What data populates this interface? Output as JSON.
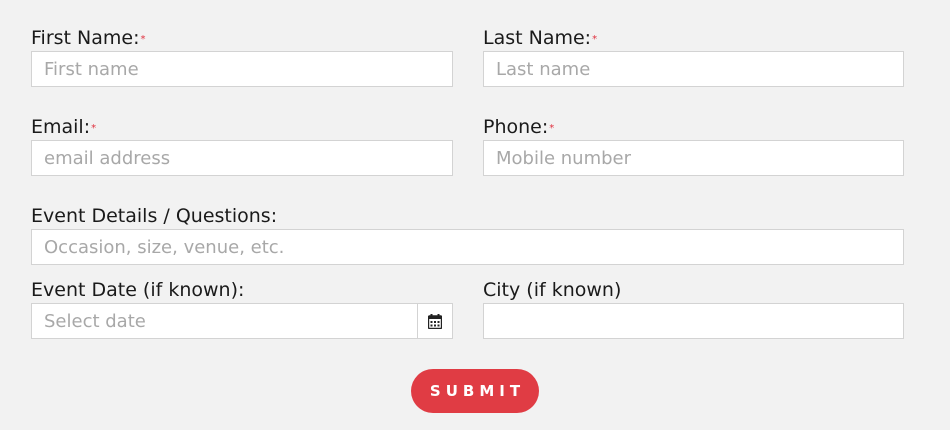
{
  "fields": {
    "first_name": {
      "label": "First Name:",
      "required": "*",
      "placeholder": "First name",
      "value": ""
    },
    "last_name": {
      "label": "Last Name:",
      "required": "*",
      "placeholder": "Last name",
      "value": ""
    },
    "email": {
      "label": "Email:",
      "required": "*",
      "placeholder": "email address",
      "value": ""
    },
    "phone": {
      "label": "Phone:",
      "required": "*",
      "placeholder": "Mobile number",
      "value": ""
    },
    "event_details": {
      "label": "Event Details / Questions:",
      "placeholder": "Occasion, size, venue, etc.",
      "value": ""
    },
    "event_date": {
      "label": "Event Date (if known):",
      "placeholder": "Select date",
      "value": "",
      "icon": "calendar-icon"
    },
    "city": {
      "label": "City (if known)",
      "placeholder": "",
      "value": ""
    }
  },
  "submit": {
    "label": "SUBMIT"
  },
  "colors": {
    "background": "#f2f2f2",
    "required_marker": "#e0313f",
    "submit_background": "#e03c44",
    "submit_text": "#ffffff"
  }
}
